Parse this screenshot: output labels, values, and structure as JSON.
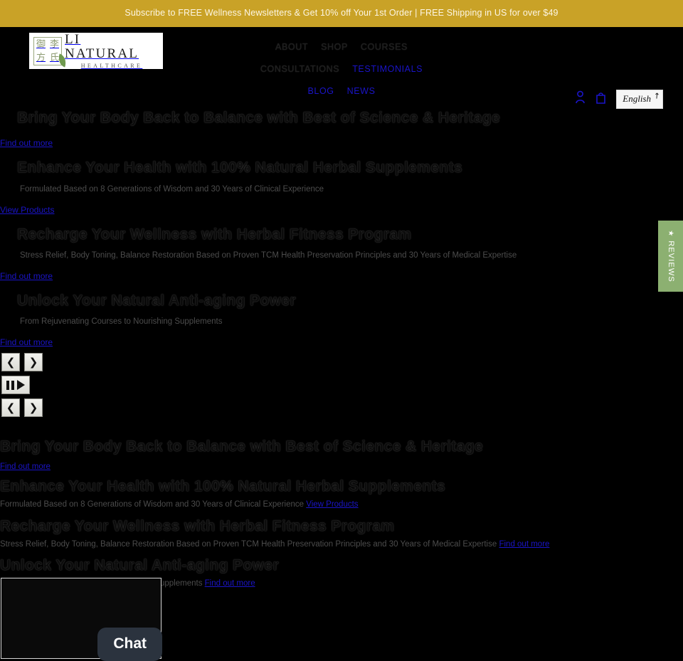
{
  "announcement": {
    "text": "Subscribe to FREE Wellness Newsletters & Get 10% off Your 1st Order | FREE Shipping in US for over $49",
    "background": "#c9a227",
    "color": "#fdf6e3"
  },
  "header": {
    "logo": {
      "seal_chars": [
        "御",
        "李",
        "方",
        "氏"
      ],
      "brand": "LI NATURAL",
      "tagline": "HEALTHCARE"
    },
    "nav": [
      {
        "label": "ABOUT",
        "style": "dim"
      },
      {
        "label": "SHOP",
        "style": "dim"
      },
      {
        "label": "COURSES",
        "style": "dim"
      },
      {
        "label": "CONSULTATIONS",
        "style": "dim"
      },
      {
        "label": "TESTIMONIALS",
        "style": "link"
      },
      {
        "label": "BLOG",
        "style": "link"
      },
      {
        "label": "NEWS",
        "style": "link"
      }
    ],
    "actions": {
      "account_icon": "person-icon",
      "cart_icon": "shopping-bag-icon",
      "language": "English",
      "language_caret": "↗"
    }
  },
  "slides": [
    {
      "heading": "Bring Your Body Back to Balance with Best of Science & Heritage",
      "subtitle": "",
      "cta": "Find out more"
    },
    {
      "heading": "Enhance Your Health with 100% Natural Herbal Supplements",
      "subtitle": "Formulated Based on 8 Generations of Wisdom and 30 Years of Clinical Experience",
      "cta": "View Products"
    },
    {
      "heading": "Recharge Your Wellness with Herbal Fitness Program",
      "subtitle": "Stress Relief, Body Toning, Balance Restoration Based on Proven TCM Health Preservation Principles and 30 Years of Medical Expertise",
      "cta": "Find out more"
    },
    {
      "heading": "Unlock Your Natural Anti-aging Power",
      "subtitle": "From Rejuvenating Courses to Nourishing Supplements",
      "cta": "Find out more"
    }
  ],
  "carousel_controls": {
    "previous": "❮",
    "next": "❯",
    "pause": "pause-icon",
    "play": "play-icon"
  },
  "reviews_tab": {
    "label": "REVIEWS",
    "star": "★",
    "background": "#8cb071"
  },
  "chat": {
    "button_label": "Chat"
  }
}
